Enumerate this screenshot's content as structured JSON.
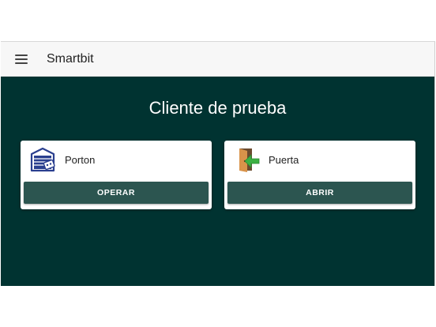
{
  "header": {
    "menu_icon": "hamburger-menu-icon",
    "title": "Smartbit"
  },
  "main": {
    "title": "Cliente de prueba",
    "devices": [
      {
        "label": "Porton",
        "icon": "garage-door-icon",
        "action_label": "OPERAR"
      },
      {
        "label": "Puerta",
        "icon": "door-enter-arrow-icon",
        "action_label": "ABRIR"
      }
    ]
  },
  "colors": {
    "background": "#003331",
    "button": "#2c5550",
    "toolbar": "#f7f7f7",
    "card": "#ffffff"
  }
}
